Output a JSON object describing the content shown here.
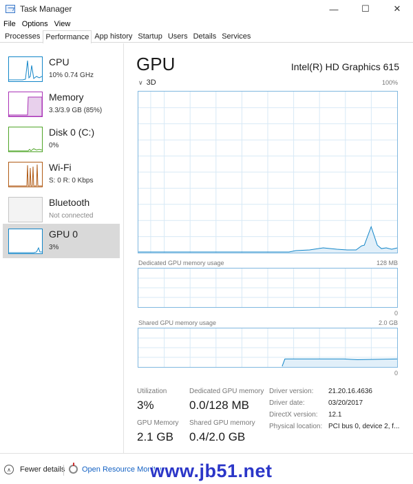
{
  "window": {
    "title": "Task Manager",
    "minimize": "—",
    "maximize": "☐",
    "close": "✕"
  },
  "menu": [
    "File",
    "Options",
    "View"
  ],
  "tabs": [
    "Processes",
    "Performance",
    "App history",
    "Startup",
    "Users",
    "Details",
    "Services"
  ],
  "sidebar": {
    "items": [
      {
        "title": "CPU",
        "subtitle": "10%  0.74 GHz",
        "color": "#1185c8"
      },
      {
        "title": "Memory",
        "subtitle": "3.3/3.9 GB (85%)",
        "color": "#a931b6"
      },
      {
        "title": "Disk 0 (C:)",
        "subtitle": "0%",
        "color": "#4ea426"
      },
      {
        "title": "Wi-Fi",
        "subtitle": "S: 0  R: 0 Kbps",
        "color": "#b05a14"
      },
      {
        "title": "Bluetooth",
        "subtitle": "Not connected",
        "color": "#b9b9b9"
      },
      {
        "title": "GPU 0",
        "subtitle": "3%",
        "color": "#1185c8"
      }
    ]
  },
  "main": {
    "title": "GPU",
    "model": "Intel(R) HD Graphics 615",
    "engine_label": "3D",
    "engine_max": "100%",
    "dedicated_label": "Dedicated GPU memory usage",
    "dedicated_max": "128 MB",
    "dedicated_min": "0",
    "shared_label": "Shared GPU memory usage",
    "shared_max": "2.0 GB",
    "shared_min": "0",
    "stats": {
      "utilization_label": "Utilization",
      "utilization": "3%",
      "dedicated_mem_label": "Dedicated GPU memory",
      "dedicated_mem": "0.0/128 MB",
      "gpu_memory_label": "GPU Memory",
      "gpu_memory": "2.1 GB",
      "shared_mem_label": "Shared GPU memory",
      "shared_mem": "0.4/2.0 GB"
    },
    "info": {
      "driver_version_label": "Driver version:",
      "driver_version": "21.20.16.4636",
      "driver_date_label": "Driver date:",
      "driver_date": "03/20/2017",
      "directx_label": "DirectX version:",
      "directx": "12.1",
      "location_label": "Physical location:",
      "location": "PCI bus 0, device 2, f..."
    }
  },
  "footer": {
    "fewer_details": "Fewer details",
    "open_resmon": "Open Resource Monitor",
    "watermark": "www.jb51.net"
  },
  "colors": {
    "gpu_graph": "#1185c8",
    "grid": "#d7e9f6",
    "accent_link": "#1462c4"
  }
}
